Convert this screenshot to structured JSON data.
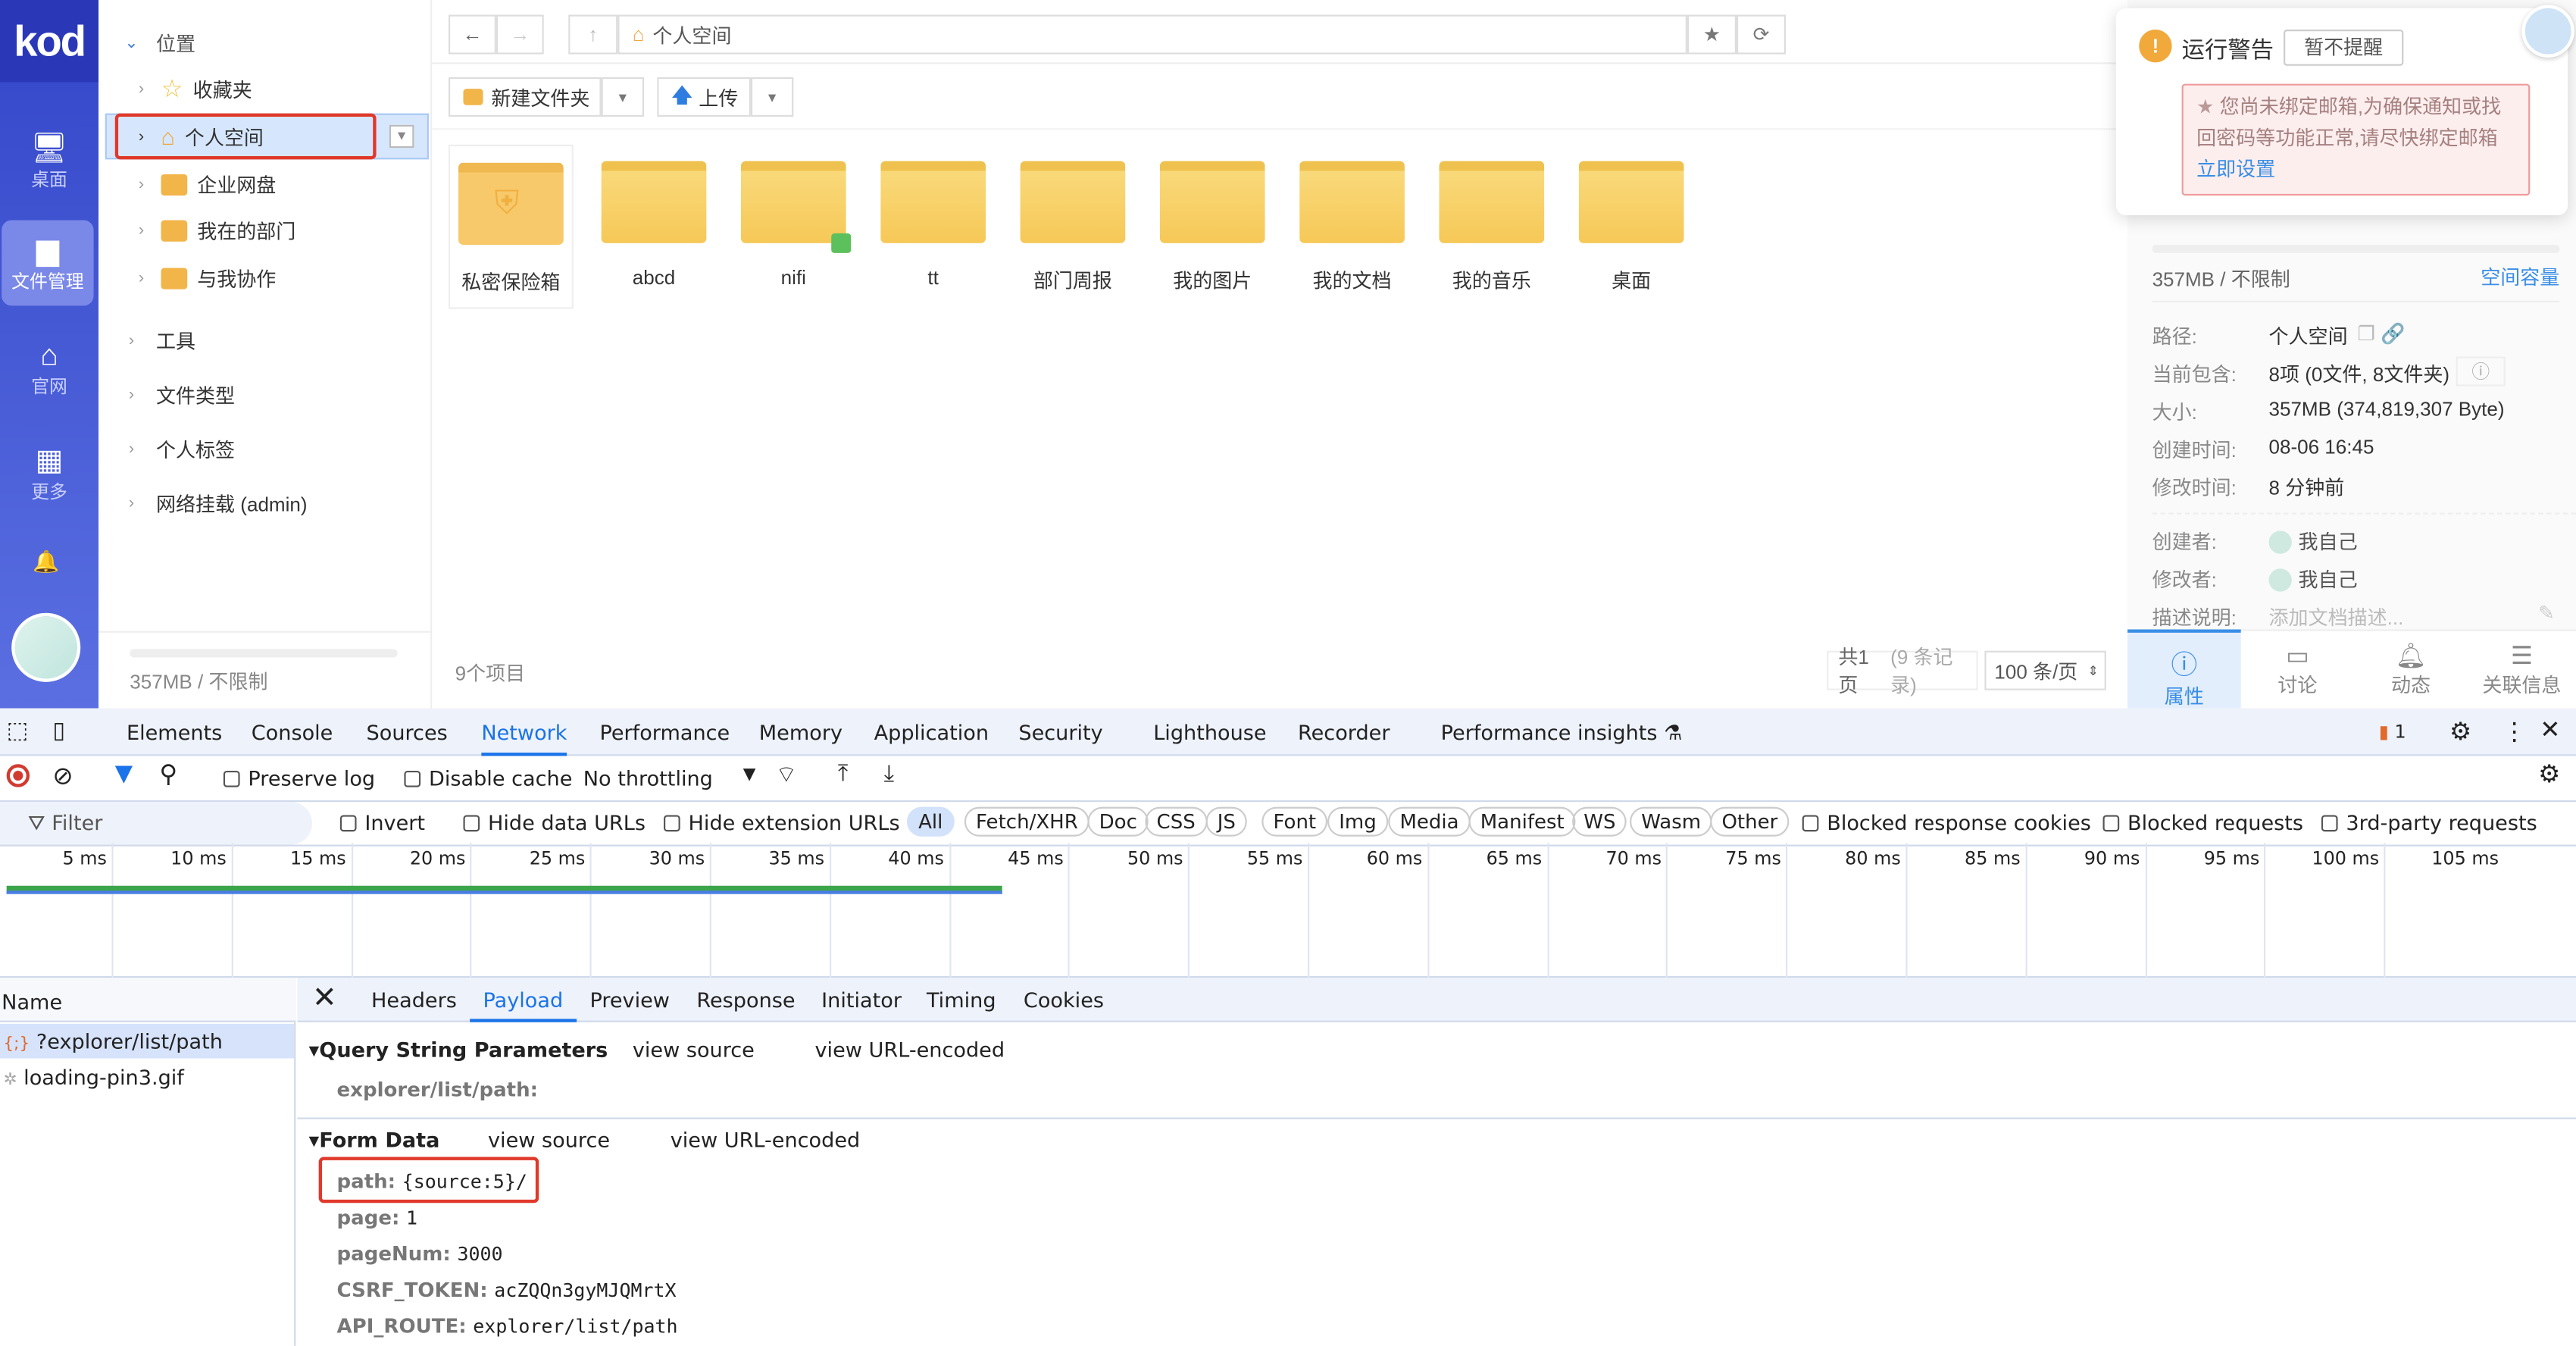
{
  "nav": {
    "logo": "kod",
    "items": [
      {
        "label": "桌面",
        "icon": "monitor-icon"
      },
      {
        "label": "文件管理",
        "icon": "folder-icon"
      },
      {
        "label": "官网",
        "icon": "home-icon"
      },
      {
        "label": "更多",
        "icon": "grid-icon"
      }
    ]
  },
  "tree": {
    "section": "位置",
    "items": [
      "收藏夹",
      "个人空间",
      "企业网盘",
      "我在的部门",
      "与我协作"
    ],
    "groups": [
      "工具",
      "文件类型",
      "个人标签",
      "网络挂载 (admin)"
    ],
    "quota": "357MB / 不限制"
  },
  "toolbar": {
    "breadcrumb": "个人空间",
    "new_folder": "新建文件夹",
    "upload": "上传"
  },
  "files": [
    "私密保险箱",
    "abcd",
    "nifi",
    "tt",
    "部门周报",
    "我的图片",
    "我的文档",
    "我的音乐",
    "桌面"
  ],
  "footer": {
    "count": "9个项目",
    "pages": "共1页",
    "records": "(9 条记录)",
    "per_page": "100 条/页"
  },
  "notice": {
    "title": "运行警告",
    "dismiss": "暂不提醒",
    "message": "您尚未绑定邮箱,为确保通知或找回密码等功能正常,请尽快绑定邮箱",
    "link": "立即设置"
  },
  "info": {
    "quota": "357MB / 不限制",
    "quota_link": "空间容量",
    "rows": [
      {
        "k": "路径:",
        "v": "个人空间"
      },
      {
        "k": "当前包含:",
        "v": "8项 (0文件, 8文件夹)"
      },
      {
        "k": "大小:",
        "v": "357MB (374,819,307 Byte)"
      },
      {
        "k": "创建时间:",
        "v": "08-06 16:45"
      },
      {
        "k": "修改时间:",
        "v": "8 分钟前"
      }
    ],
    "creator_label": "创建者:",
    "creator": "我自己",
    "modifier_label": "修改者:",
    "modifier": "我自己",
    "desc_label": "描述说明:",
    "desc_placeholder": "添加文档描述...",
    "tabs": [
      "属性",
      "讨论",
      "动态",
      "关联信息"
    ]
  },
  "devtools": {
    "tabs": [
      "Elements",
      "Console",
      "Sources",
      "Network",
      "Performance",
      "Memory",
      "Application",
      "Security",
      "Lighthouse",
      "Recorder",
      "Performance insights"
    ],
    "active_tab": "Network",
    "issues": "1",
    "toolbar": {
      "preserve_log": "Preserve log",
      "disable_cache": "Disable cache",
      "throttling": "No throttling"
    },
    "filter": {
      "placeholder": "Filter",
      "invert": "Invert",
      "hide_data": "Hide data URLs",
      "hide_ext": "Hide extension URLs",
      "types": [
        "All",
        "Fetch/XHR",
        "Doc",
        "CSS",
        "JS",
        "Font",
        "Img",
        "Media",
        "Manifest",
        "WS",
        "Wasm",
        "Other"
      ],
      "blocked_cookies": "Blocked response cookies",
      "blocked_requests": "Blocked requests",
      "third_party": "3rd-party requests"
    },
    "ticks": [
      "5 ms",
      "10 ms",
      "15 ms",
      "20 ms",
      "25 ms",
      "30 ms",
      "35 ms",
      "40 ms",
      "45 ms",
      "50 ms",
      "55 ms",
      "60 ms",
      "65 ms",
      "70 ms",
      "75 ms",
      "80 ms",
      "85 ms",
      "90 ms",
      "95 ms",
      "100 ms",
      "105 ms"
    ],
    "name_header": "Name",
    "requests": [
      "?explorer/list/path",
      "loading-pin3.gif"
    ],
    "detail_tabs": [
      "Headers",
      "Payload",
      "Preview",
      "Response",
      "Initiator",
      "Timing",
      "Cookies"
    ],
    "qs": {
      "title": "Query String Parameters",
      "view_source": "view source",
      "view_encoded": "view URL-encoded",
      "key": "explorer/list/path:"
    },
    "form": {
      "title": "Form Data",
      "view_source": "view source",
      "view_encoded": "view URL-encoded",
      "fields": [
        {
          "k": "path:",
          "v": "{source:5}/"
        },
        {
          "k": "page:",
          "v": "1"
        },
        {
          "k": "pageNum:",
          "v": "3000"
        },
        {
          "k": "CSRF_TOKEN:",
          "v": "acZQQn3gyMJQMrtX"
        },
        {
          "k": "API_ROUTE:",
          "v": "explorer/list/path"
        }
      ]
    }
  },
  "colors": {
    "accent": "#1a73e8",
    "highlight": "#e0392b",
    "nav": "#3f51d6",
    "folder": "#f6c857"
  }
}
